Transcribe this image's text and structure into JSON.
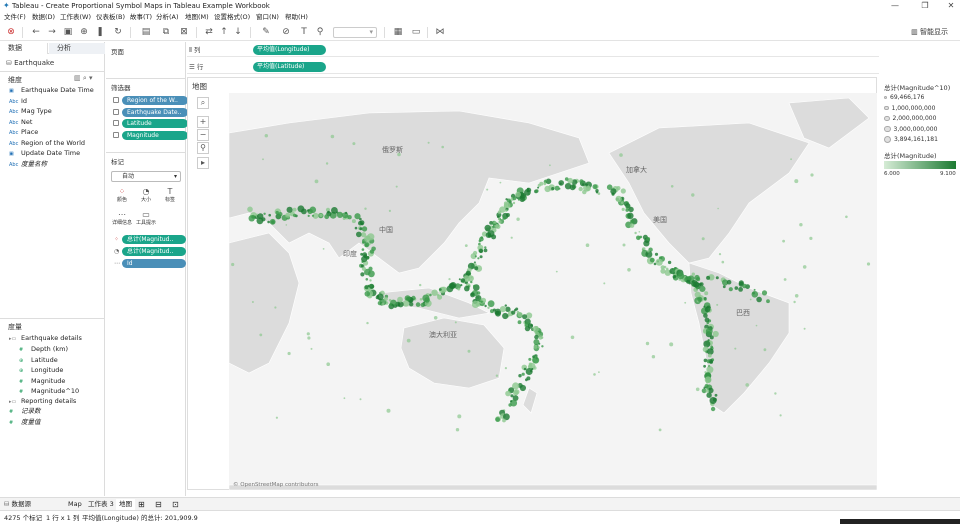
{
  "window": {
    "title": "Tableau - Create Proportional Symbol Maps in Tableau Example Workbook"
  },
  "menu": [
    "文件(F)",
    "数据(D)",
    "工作表(W)",
    "仪表板(B)",
    "故事(T)",
    "分析(A)",
    "地图(M)",
    "设置格式(O)",
    "窗口(N)",
    "帮助(H)"
  ],
  "toolbar": {
    "smart_show": "智能显示"
  },
  "data_pane": {
    "tab_data": "数据",
    "tab_analytics": "分析",
    "datasource": "Earthquake",
    "dimensions_header": "维度",
    "dimensions": [
      {
        "type": "date",
        "name": "Earthquake Date Time"
      },
      {
        "type": "abc",
        "name": "Id"
      },
      {
        "type": "abc",
        "name": "Mag Type"
      },
      {
        "type": "abc",
        "name": "Net"
      },
      {
        "type": "abc",
        "name": "Place"
      },
      {
        "type": "abc",
        "name": "Region of the World"
      },
      {
        "type": "date",
        "name": "Update Date Time"
      },
      {
        "type": "abc",
        "name": "度量名称"
      }
    ],
    "measures_header": "度量",
    "measure_group1": "Earthquake details",
    "measures1": [
      "Depth (km)",
      "Latitude",
      "Longitude",
      "Magnitude",
      "Magnitude^10"
    ],
    "measure_group2": "Reporting details",
    "measures2": [
      "记录数",
      "度量值"
    ]
  },
  "pages_label": "页面",
  "filters": {
    "header": "筛选器",
    "items": [
      "Region of the W..",
      "Earthquake Date..",
      "Latitude",
      "Magnitude"
    ]
  },
  "marks": {
    "header": "标记",
    "type": "自动",
    "buttons": [
      "颜色",
      "大小",
      "标签",
      "详细信息",
      "工具提示"
    ],
    "pills": [
      "总计(Magnitud..",
      "总计(Magnitud..",
      "Id"
    ]
  },
  "shelves": {
    "columns_label": "列",
    "columns_pill": "平均值(Longitude)",
    "rows_label": "行",
    "rows_pill": "平均值(Latitude)"
  },
  "viz": {
    "title": "地图",
    "attribution": "© OpenStreetMap contributors",
    "countries": [
      "俄罗斯",
      "加拿大",
      "美国",
      "中国",
      "印度",
      "澳大利亚",
      "巴西"
    ]
  },
  "legend": {
    "size_title": "总计(Magnitude^10)",
    "size_items": [
      "69,466,176",
      "1,000,000,000",
      "2,000,000,000",
      "3,000,000,000",
      "3,894,161,181"
    ],
    "color_title": "总计(Magnitude)",
    "color_min": "6.000",
    "color_max": "9.100"
  },
  "sheet_tabs": [
    "数据源",
    "Map",
    "工作表 3",
    "地图"
  ],
  "status": {
    "marks": "4275 个标记",
    "rowscols": "1 行 x 1 列",
    "sum": "平均值(Longitude) 的总计: 201,909.9"
  },
  "colors": {
    "accent": "#1aa58a",
    "pill_blue": "#4a8fb8",
    "quake_dark": "#1c7a32"
  }
}
